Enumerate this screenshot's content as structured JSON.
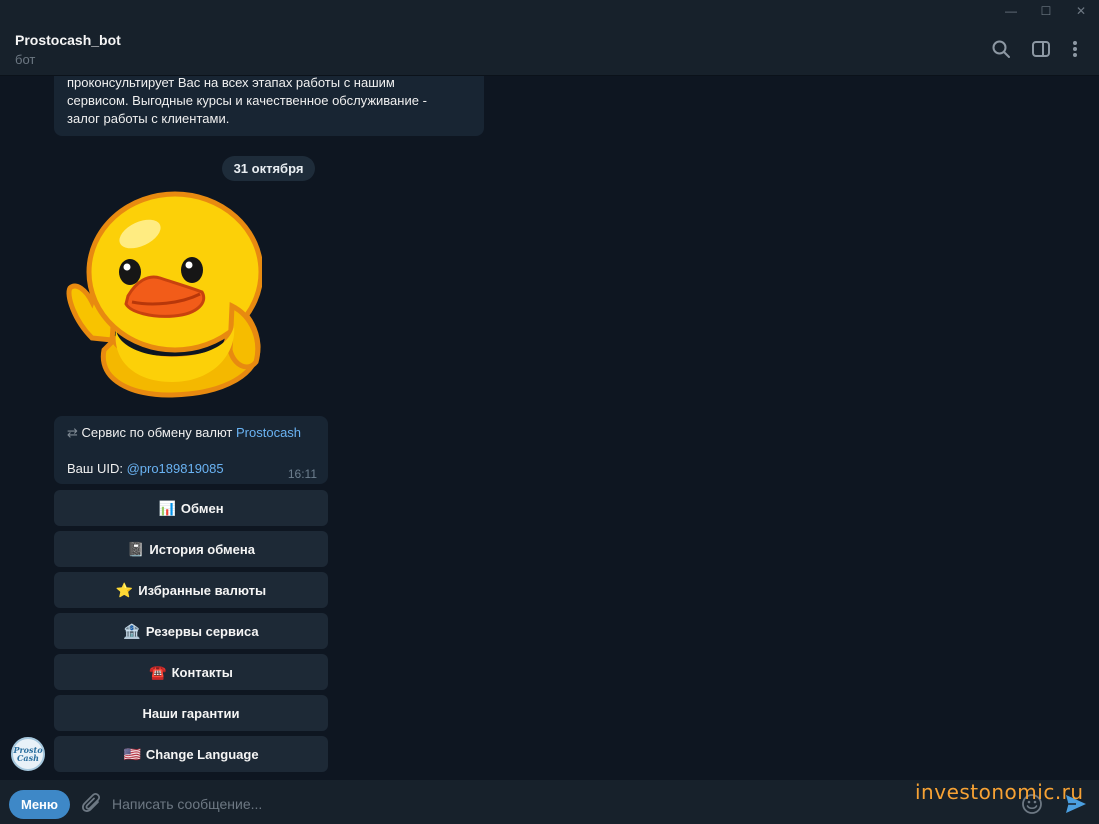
{
  "window": {
    "minimize": "—",
    "maximize": "☐",
    "close": "✕"
  },
  "header": {
    "title": "Prostocash_bot",
    "subtitle": "бот"
  },
  "messages": {
    "intro_lines": [
      "проконсультирует Вас на всех этапах работы с нашим",
      "сервисом. Выгодные курсы и качественное обслуживание -",
      "залог работы с клиентами."
    ],
    "date_divider": "31 октября",
    "service_prefix": "Сервис по обмену валют ",
    "service_link": "Prostocash",
    "uid_prefix": "Ваш UID: ",
    "uid_value": "@pro189819085",
    "time": "16:11"
  },
  "keyboard": [
    {
      "emoji": "📊",
      "label": "Обмен"
    },
    {
      "emoji": "📓",
      "label": "История обмена"
    },
    {
      "emoji": "⭐",
      "label": "Избранные валюты"
    },
    {
      "emoji": "🏦",
      "label": "Резервы сервиса"
    },
    {
      "emoji": "☎️",
      "label": "Контакты"
    },
    {
      "emoji": "",
      "label": "Наши гарантии"
    },
    {
      "emoji": "🇺🇸",
      "label": "Change Language"
    }
  ],
  "avatar": {
    "line1": "Prosto",
    "line2": "Cash"
  },
  "composer": {
    "menu_label": "Меню",
    "placeholder": "Написать сообщение..."
  },
  "watermark": "investonomic.ru",
  "colors": {
    "background": "#0e1621",
    "panel": "#17212b",
    "bubble": "#182533",
    "accent": "#3e88c7",
    "link": "#6ab3f3"
  }
}
